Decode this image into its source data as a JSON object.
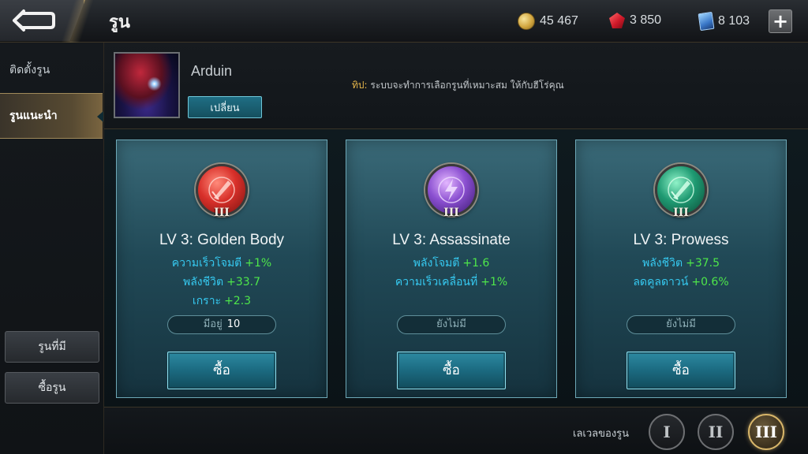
{
  "header": {
    "title": "รูน",
    "back_icon": "back-arrow-icon",
    "currencies": [
      {
        "icon": "gold-coin-icon",
        "value": "45 467",
        "color": "#d2a640"
      },
      {
        "icon": "ruby-gem-icon",
        "value": "3 850",
        "color": "#d11a2a"
      },
      {
        "icon": "voucher-card-icon",
        "value": "8 103",
        "color": "#3a78c8"
      }
    ],
    "add_label": "+"
  },
  "sidebar": {
    "tabs": [
      {
        "label": "ติดตั้งรูน",
        "active": false
      },
      {
        "label": "รูนแนะนำ",
        "active": true
      }
    ],
    "buttons": [
      {
        "label": "รูนที่มี"
      },
      {
        "label": "ซื้อรูน"
      }
    ]
  },
  "hero": {
    "name": "Arduin",
    "change_label": "เปลี่ยน",
    "tip_label": "ทิป:",
    "tip_text": "ระบบจะทำการเลือกรูนที่เหมาะสม ให้กับฮีโร่คุณ"
  },
  "runes": [
    {
      "color": "red",
      "level_numeral": "III",
      "title": "LV 3: Golden Body",
      "stats": [
        {
          "name": "ความเร็วโจมตี",
          "value": "+1%"
        },
        {
          "name": "พลังชีวิต",
          "value": "+33.7"
        },
        {
          "name": "เกราะ",
          "value": "+2.3"
        }
      ],
      "owned_label": "มีอยู่",
      "owned_value": "10",
      "buy_label": "ซื้อ"
    },
    {
      "color": "purple",
      "level_numeral": "III",
      "title": "LV 3: Assassinate",
      "stats": [
        {
          "name": "พลังโจมตี",
          "value": "+1.6"
        },
        {
          "name": "ความเร็วเคลื่อนที่",
          "value": "+1%"
        }
      ],
      "owned_text": "ยังไม่มี",
      "buy_label": "ซื้อ"
    },
    {
      "color": "green",
      "level_numeral": "III",
      "title": "LV 3: Prowess",
      "stats": [
        {
          "name": "พลังชีวิต",
          "value": "+37.5"
        },
        {
          "name": "ลดคูลดาวน์",
          "value": "+0.6%"
        }
      ],
      "owned_text": "ยังไม่มี",
      "buy_label": "ซื้อ"
    }
  ],
  "footer": {
    "level_label": "เลเวลของรูน",
    "levels": [
      "I",
      "II",
      "III"
    ],
    "selected_level": "III"
  },
  "colors": {
    "accent_gold": "#d8b66a",
    "stat_name": "#36c9f0",
    "stat_value": "#4ee64a",
    "tip_label": "#e6b64a"
  }
}
